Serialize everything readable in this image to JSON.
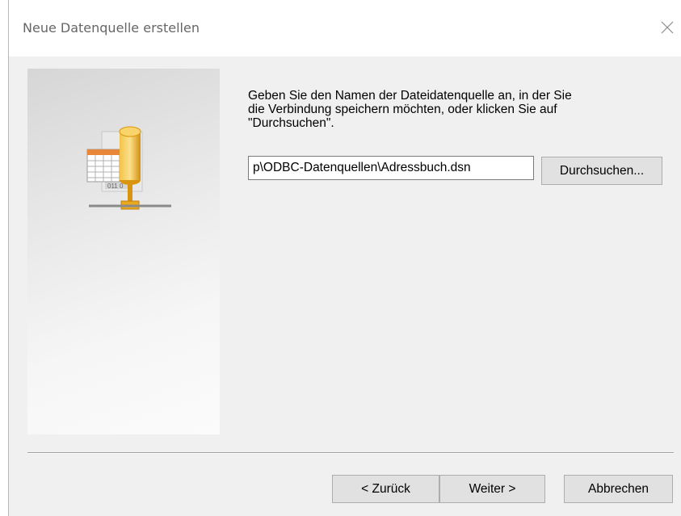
{
  "window": {
    "title": "Neue Datenquelle erstellen",
    "close_icon": "close-icon"
  },
  "side_panel": {
    "icon": "data-source-icon"
  },
  "content": {
    "instruction": "Geben Sie den Namen der Dateidatenquelle an, in der Sie\ndie Verbindung speichern möchten, oder klicken Sie auf\n\"Durchsuchen\".",
    "path_value": "p\\ODBC-Datenquellen\\Adressbuch.dsn",
    "browse_label": "Durchsuchen..."
  },
  "footer": {
    "back_label": "< Zurück",
    "next_label": "Weiter >",
    "cancel_label": "Abbrechen"
  }
}
